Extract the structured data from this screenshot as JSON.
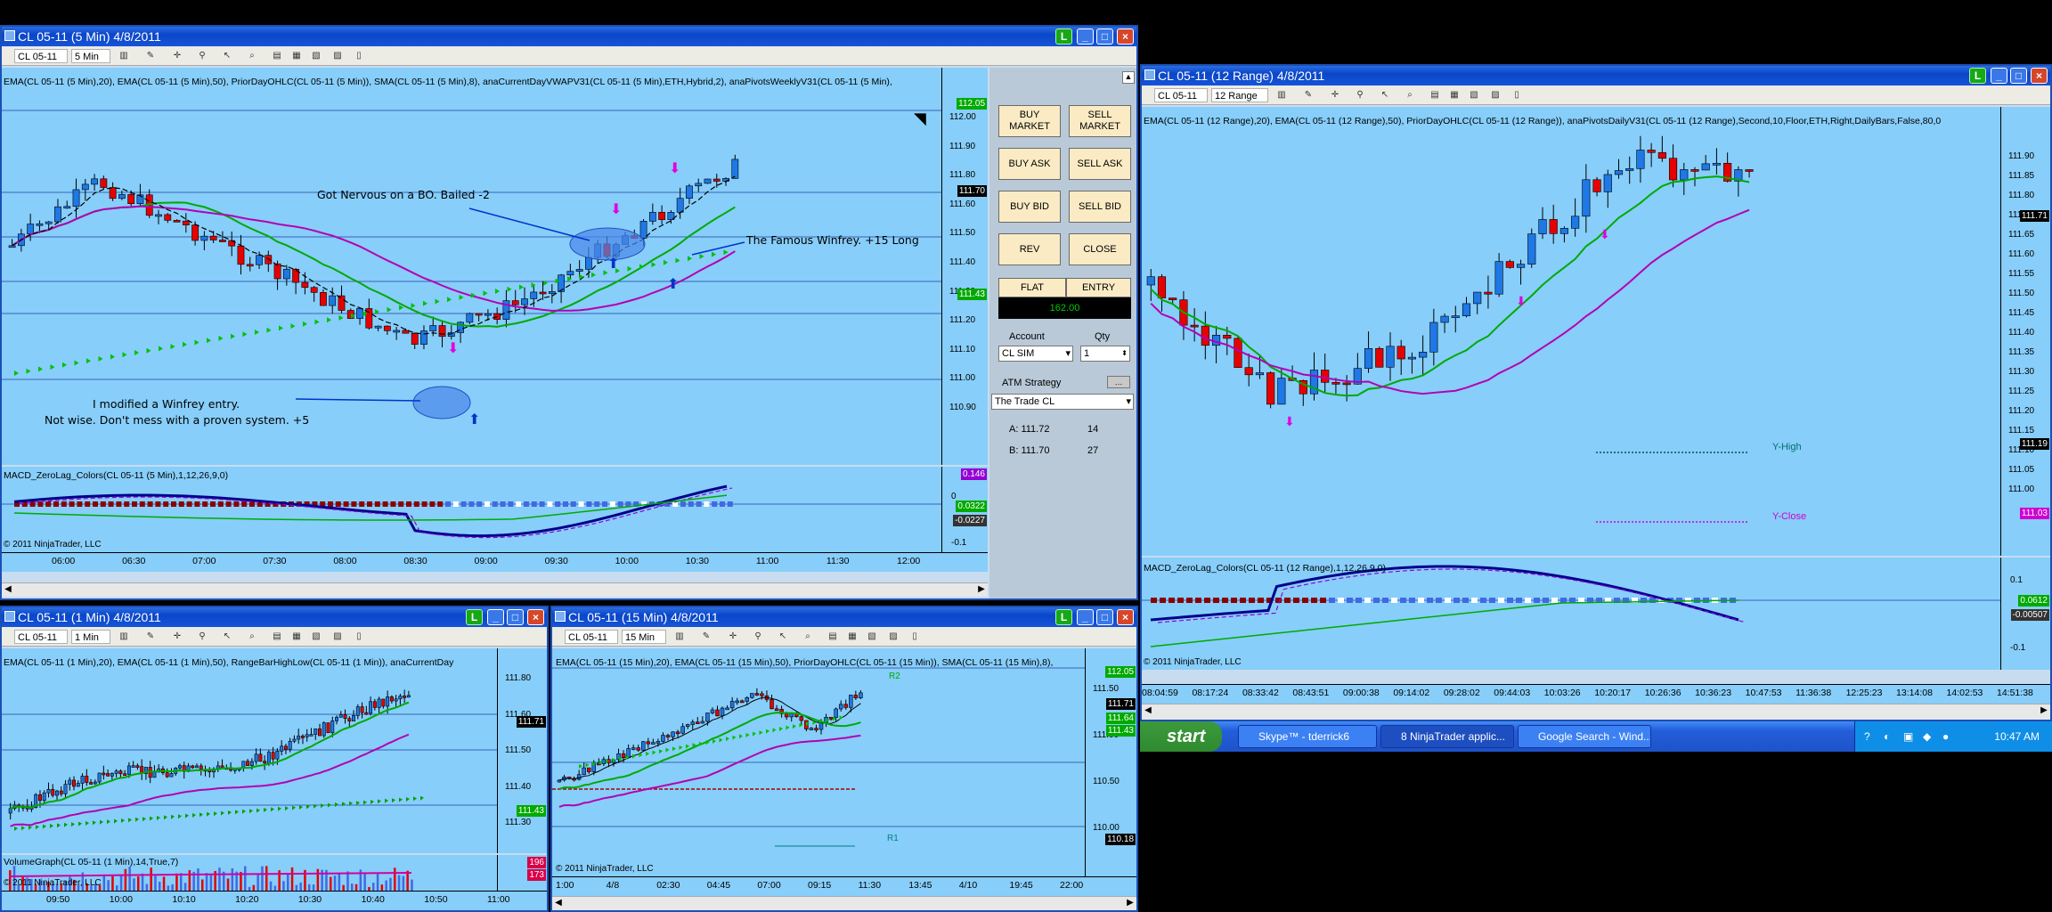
{
  "colors": {
    "chart_bg": "#87cefa",
    "up": "#1e78e6",
    "down": "#e60000",
    "ema20": "#00aa00",
    "ema50": "#b400b4",
    "vwap": "#000000",
    "macd": "#00008b",
    "signal": "#9400d3",
    "accent": "#0a46c8"
  },
  "win5": {
    "title": "CL 05-11 (5 Min)  4/8/2011",
    "instrument": "CL 05-11",
    "interval": "5 Min",
    "indicators": "EMA(CL 05-11 (5 Min),20), EMA(CL 05-11 (5 Min),50), PriorDayOHLC(CL 05-11 (5 Min)), SMA(CL 05-11 (5 Min),8), anaCurrentDayVWAPV31(CL 05-11 (5 Min),ETH,Hybrid,2), anaPivotsWeeklyV31(CL 05-11 (5 Min),",
    "prices": [
      "112.00",
      "111.90",
      "111.80",
      "111.60",
      "111.50",
      "111.40",
      "111.30",
      "111.20",
      "111.10",
      "111.00",
      "110.90"
    ],
    "tag_top": "112.05",
    "tag_last": "111.70",
    "tag_green": "111.43",
    "anno1": "Got Nervous on a BO. Bailed -2",
    "anno2": "The Famous Winfrey. +15 Long",
    "anno3a": "I modified a Winfrey entry.",
    "anno3b": "Not wise. Don't mess with a proven system. +5",
    "macd_label": "MACD_ZeroLag_Colors(CL 05-11 (5 Min),1,12,26,9,0)",
    "macd_vals": {
      "a": "0.146",
      "b": "0.0322",
      "c": "-0.0227",
      "zero": "0",
      "neg": "-0.1"
    },
    "copyright": "© 2011 NinjaTrader, LLC",
    "times": [
      "06:00",
      "06:30",
      "07:00",
      "07:30",
      "08:00",
      "08:30",
      "09:00",
      "09:30",
      "10:00",
      "10:30",
      "11:00",
      "11:30",
      "12:00"
    ]
  },
  "order": {
    "buy_market": "BUY MARKET",
    "sell_market": "SELL MARKET",
    "buy_ask": "BUY ASK",
    "sell_ask": "SELL ASK",
    "buy_bid": "BUY BID",
    "sell_bid": "SELL BID",
    "rev": "REV",
    "close": "CLOSE",
    "flat": "FLAT",
    "entry": "ENTRY",
    "pnl": "162.00",
    "account_label": "Account",
    "qty_label": "Qty",
    "account": "CL SIM",
    "qty": "1",
    "atm_label": "ATM Strategy",
    "atm": "The Trade CL",
    "ask": "A: 111.72",
    "ask_size": "14",
    "bid": "B: 111.70",
    "bid_size": "27"
  },
  "win1": {
    "title": "CL 05-11 (1 Min)  4/8/2011",
    "instrument": "CL 05-11",
    "interval": "1 Min",
    "indicators": "EMA(CL 05-11 (1 Min),20), EMA(CL 05-11 (1 Min),50), RangeBarHighLow(CL 05-11 (1 Min)), anaCurrentDay",
    "prices": [
      "111.80",
      "111.60",
      "111.50",
      "111.40",
      "111.30"
    ],
    "tag_last": "111.71",
    "tag_green": "111.43",
    "vol_label": "VolumeGraph(CL 05-11 (1 Min),14,True,7)",
    "vol_tag1": "196",
    "vol_tag2": "173",
    "copyright": "© 2011 NinjaTrader, LLC",
    "times": [
      "09:50",
      "10:00",
      "10:10",
      "10:20",
      "10:30",
      "10:40",
      "10:50",
      "11:00"
    ]
  },
  "win15": {
    "title": "CL 05-11 (15 Min)  4/8/2011",
    "instrument": "CL 05-11",
    "interval": "15 Min",
    "indicators": "EMA(CL 05-11 (15 Min),20), EMA(CL 05-11 (15 Min),50), PriorDayOHLC(CL 05-11 (15 Min)), SMA(CL 05-11 (15 Min),8),",
    "prices": [
      "111.50",
      "111.00",
      "110.50",
      "110.00"
    ],
    "tag_top": "112.05",
    "tag_last": "111.71",
    "tag_a": "111.64",
    "tag_green": "111.43",
    "tag_r": "110.18",
    "r2": "R2",
    "r1": "R1",
    "copyright": "© 2011 NinjaTrader, LLC",
    "times": [
      "1:00",
      "4/8",
      "02:30",
      "04:45",
      "07:00",
      "09:15",
      "11:30",
      "13:45",
      "4/10",
      "19:45",
      "22:00"
    ]
  },
  "win12": {
    "title": "CL 05-11 (12 Range)  4/8/2011",
    "instrument": "CL 05-11",
    "interval": "12 Range",
    "indicators": "EMA(CL 05-11 (12 Range),20), EMA(CL 05-11 (12 Range),50), PriorDayOHLC(CL 05-11 (12 Range)), anaPivotsDailyV31(CL 05-11 (12 Range),Second,10,Floor,ETH,Right,DailyBars,False,80,0",
    "prices": [
      "111.90",
      "111.85",
      "111.80",
      "111.75",
      "111.65",
      "111.60",
      "111.55",
      "111.50",
      "111.45",
      "111.40",
      "111.35",
      "111.30",
      "111.25",
      "111.20",
      "111.15",
      "111.10",
      "111.05",
      "111.00"
    ],
    "tag_last": "111.71",
    "tag_yhigh": "111.19",
    "tag_yclose": "111.03",
    "yhigh": "Y-High",
    "yclose": "Y-Close",
    "macd_label": "MACD_ZeroLag_Colors(CL 05-11 (12 Range),1,12,26,9,0)",
    "macd_vals": {
      "a": "0.1",
      "b": "0.0612",
      "c": "-0.00507",
      "neg": "-0.1"
    },
    "copyright": "© 2011 NinjaTrader, LLC",
    "times": [
      "08:04:59",
      "08:17:24",
      "08:33:42",
      "08:43:51",
      "09:00:38",
      "09:14:02",
      "09:28:02",
      "09:44:03",
      "10:03:26",
      "10:20:17",
      "10:26:36",
      "10:36:23",
      "10:47:53",
      "11:36:38",
      "12:25:23",
      "13:14:08",
      "14:02:53",
      "14:51:38"
    ]
  },
  "taskbar": {
    "start": "start",
    "tasks": [
      "Skype™ - tderrick6",
      "8 NinjaTrader applic...",
      "Google Search - Wind..."
    ],
    "clock": "10:47 AM"
  }
}
